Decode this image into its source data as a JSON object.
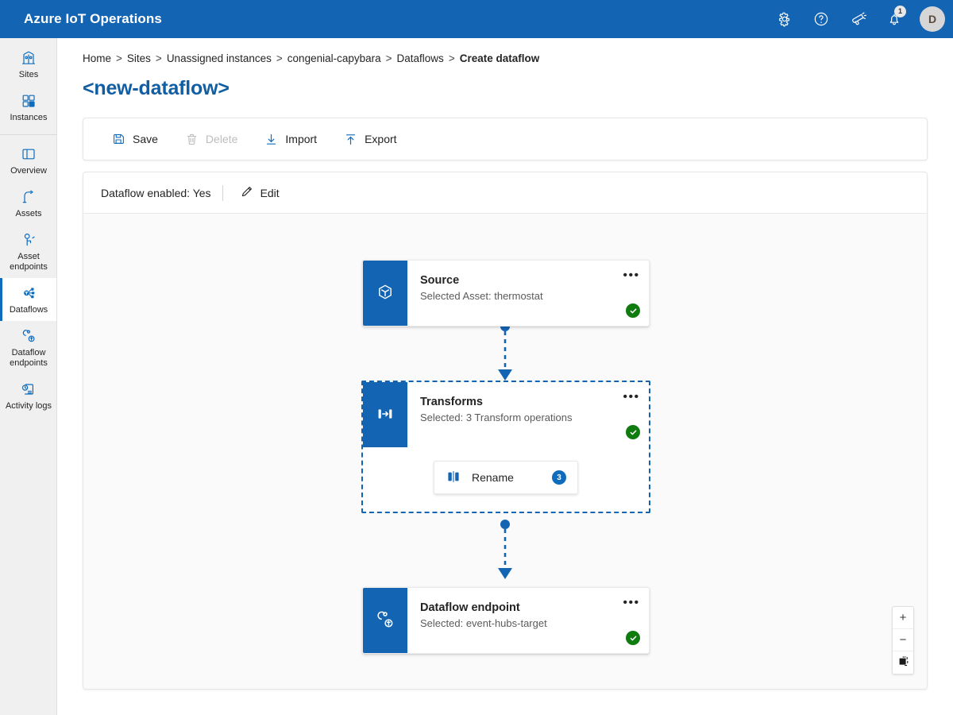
{
  "header": {
    "brand": "Azure IoT Operations",
    "actions": [
      {
        "name": "settings-icon",
        "label": "Settings"
      },
      {
        "name": "help-icon",
        "label": "Help"
      },
      {
        "name": "feedback-icon",
        "label": "Feedback"
      },
      {
        "name": "notifications-icon",
        "label": "Notifications",
        "badge": "1"
      }
    ],
    "avatar_initial": "D"
  },
  "sidebar": {
    "items": [
      {
        "label": "Sites",
        "icon": "sites-icon",
        "selected": false
      },
      {
        "label": "Instances",
        "icon": "instances-icon",
        "selected": false
      },
      {
        "label": "Overview",
        "icon": "overview-icon",
        "selected": false
      },
      {
        "label": "Assets",
        "icon": "assets-icon",
        "selected": false
      },
      {
        "label": "Asset endpoints",
        "icon": "asset-endpoints-icon",
        "selected": false
      },
      {
        "label": "Dataflows",
        "icon": "dataflows-icon",
        "selected": true
      },
      {
        "label": "Dataflow endpoints",
        "icon": "dataflow-endpoints-icon",
        "selected": false
      },
      {
        "label": "Activity logs",
        "icon": "activity-logs-icon",
        "selected": false
      }
    ]
  },
  "breadcrumb": {
    "separator": ">",
    "items": [
      {
        "label": "Home"
      },
      {
        "label": "Sites"
      },
      {
        "label": "Unassigned instances"
      },
      {
        "label": "congenial-capybara"
      },
      {
        "label": "Dataflows"
      },
      {
        "label": "Create dataflow"
      }
    ]
  },
  "page": {
    "title": "<new-dataflow>"
  },
  "toolbar": {
    "save_label": "Save",
    "delete_label": "Delete",
    "import_label": "Import",
    "export_label": "Export"
  },
  "enabled_bar": {
    "status_text": "Dataflow enabled: Yes",
    "edit_label": "Edit"
  },
  "diagram": {
    "nodes": [
      {
        "id": "source",
        "icon": "cube-icon",
        "title": "Source",
        "subtitle": "Selected Asset: thermostat",
        "menu": "•••",
        "status": "complete"
      },
      {
        "id": "transforms",
        "icon": "transform-icon",
        "title": "Transforms",
        "subtitle": "Selected: 3 Transform operations",
        "menu": "•••",
        "status": "complete",
        "selected": true,
        "children": [
          {
            "id": "rename",
            "icon": "rename-icon",
            "label": "Rename",
            "badge": "3"
          }
        ]
      },
      {
        "id": "dataflow-endpoint",
        "icon": "endpoint-icon",
        "title": "Dataflow endpoint",
        "subtitle": "Selected: event-hubs-target",
        "menu": "•••",
        "status": "complete"
      }
    ],
    "zoom_controls": {
      "zoom_in": "+",
      "zoom_out": "−",
      "fit_view": "fit-to-view"
    }
  },
  "colors": {
    "brand_blue": "#1464b4",
    "accent_blue": "#0f6cbd",
    "title_blue": "#115ea3",
    "success_green": "#107c10",
    "canvas_bg": "#fafafa",
    "sidebar_bg": "#f0f0f0"
  }
}
